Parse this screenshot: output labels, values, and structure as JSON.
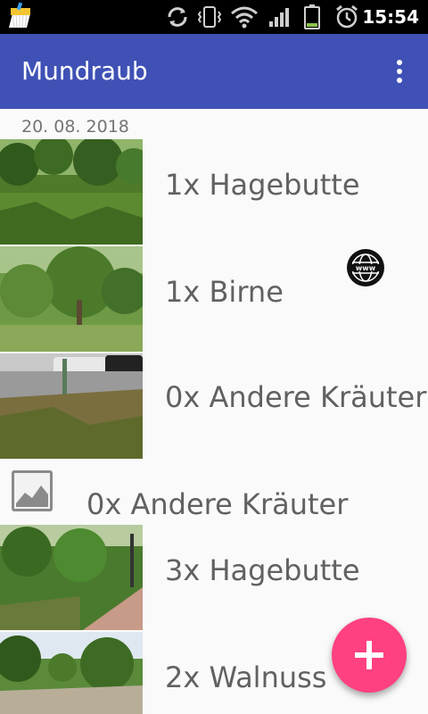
{
  "status_bar": {
    "time": "15:54",
    "icons": [
      "cleaner-app-icon",
      "sync-icon",
      "vibrate-icon",
      "wifi-icon",
      "signal-icon",
      "battery-icon",
      "alarm-icon"
    ]
  },
  "app_bar": {
    "title": "Mundraub",
    "overflow_icon": "more-vert-icon"
  },
  "list": {
    "date_header": "20. 08. 2018",
    "items": [
      {
        "label": "1x Hagebutte",
        "thumbnail": "photo"
      },
      {
        "label": "1x Birne",
        "thumbnail": "photo"
      },
      {
        "label": "0x Andere Kräuter",
        "thumbnail": "photo"
      },
      {
        "label": "0x Andere Kräuter",
        "thumbnail": "image-placeholder-icon"
      },
      {
        "label": "3x Hagebutte",
        "thumbnail": "photo"
      },
      {
        "label": "2x Walnuss",
        "thumbnail": "photo"
      }
    ]
  },
  "web_badge_icon": "www-globe-icon",
  "fab": {
    "icon": "add-icon"
  },
  "colors": {
    "app_bar": "#3f51b5",
    "fab": "#ff4081",
    "text_secondary": "#616161",
    "background": "#fafafa"
  }
}
